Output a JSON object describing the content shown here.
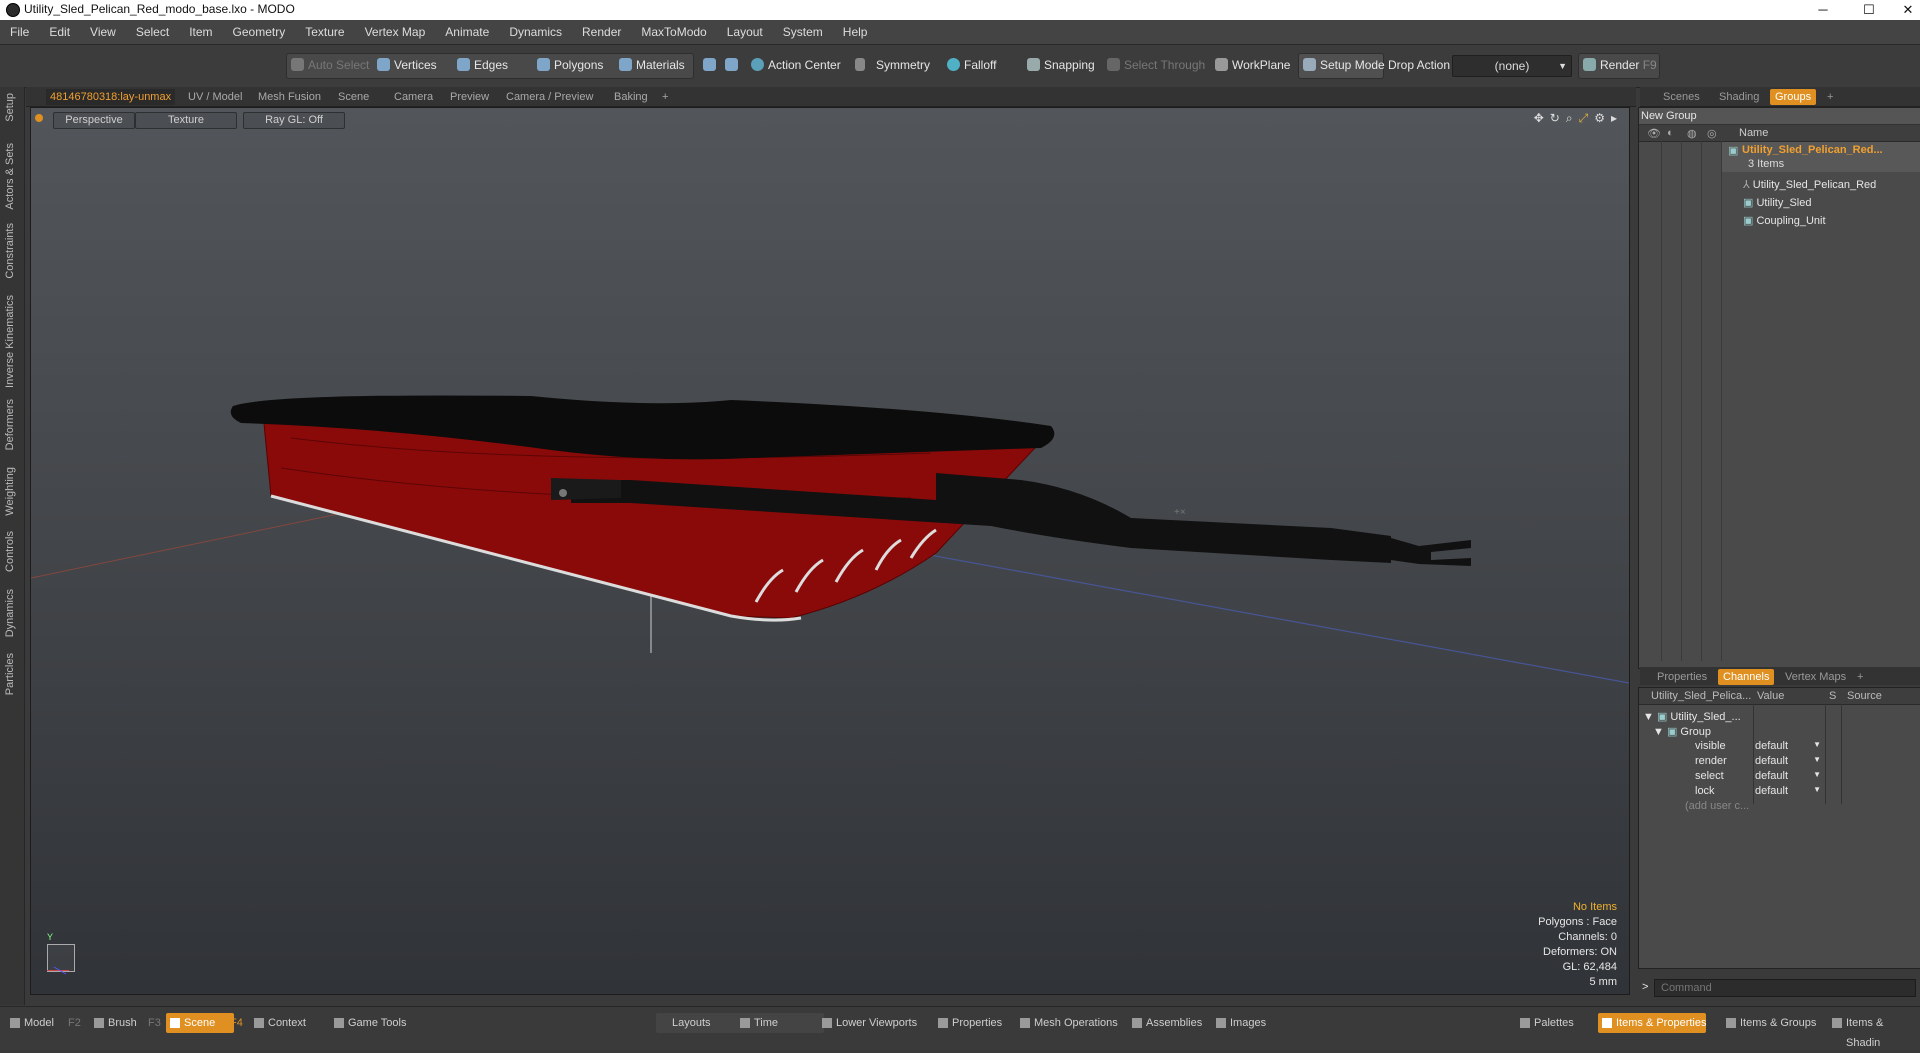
{
  "window": {
    "title": "Utility_Sled_Pelican_Red_modo_base.lxo - MODO",
    "min": "─",
    "max": "☐",
    "close": "✕"
  },
  "menu": [
    "File",
    "Edit",
    "View",
    "Select",
    "Item",
    "Geometry",
    "Texture",
    "Vertex Map",
    "Animate",
    "Dynamics",
    "Render",
    "MaxToModo",
    "Layout",
    "System",
    "Help"
  ],
  "toolbar": {
    "auto_select": "Auto Select",
    "vertices": "Vertices",
    "edges": "Edges",
    "polygons": "Polygons",
    "materials": "Materials",
    "action_center": "Action Center",
    "symmetry": "Symmetry",
    "falloff": "Falloff",
    "snapping": "Snapping",
    "select_through": "Select Through",
    "workplane": "WorkPlane",
    "setup_mode": "Setup Mode",
    "drop_action": "Drop Action",
    "drop_value": "(none)",
    "render": "Render",
    "render_key": "F9"
  },
  "left_tabs": [
    "Setup",
    "Actors & Sets",
    "Constraints",
    "Inverse Kinematics",
    "Deformers",
    "Weighting",
    "Controls",
    "Dynamics",
    "Particles"
  ],
  "viewport_tabs": [
    "48146780318:lay-unmax",
    "UV / Model",
    "Mesh Fusion",
    "Scene",
    "Camera",
    "Preview",
    "Camera / Preview",
    "Baking",
    "+"
  ],
  "viewport": {
    "perspective": "Perspective",
    "texture": "Texture",
    "raygl": "Ray GL: Off",
    "info": {
      "items": "No Items",
      "polygons": "Polygons : Face",
      "channels": "Channels: 0",
      "deformers": "Deformers: ON",
      "gl": "GL: 62,484",
      "size": "5 mm"
    },
    "axis_y": "Y"
  },
  "right_tabs": [
    "Scenes",
    "Shading",
    "Groups",
    "+"
  ],
  "groups": {
    "new_group": "New Group",
    "name_header": "Name",
    "root": "Utility_Sled_Pelican_Red...",
    "count": "3 Items",
    "children": [
      "Utility_Sled_Pelican_Red",
      "Utility_Sled",
      "Coupling_Unit"
    ]
  },
  "channel_tabs": [
    "Properties",
    "Channels",
    "Vertex Maps",
    "+"
  ],
  "channels": {
    "headers": [
      "Utility_Sled_Pelica...",
      "Value",
      "S",
      "Source"
    ],
    "item": "Utility_Sled_...",
    "group": "Group",
    "rows": [
      {
        "name": "visible",
        "value": "default"
      },
      {
        "name": "render",
        "value": "default"
      },
      {
        "name": "select",
        "value": "default"
      },
      {
        "name": "lock",
        "value": "default"
      }
    ],
    "add": "(add user c..."
  },
  "command": {
    "prompt": ">",
    "placeholder": "Command"
  },
  "bottom": {
    "model": "Model",
    "f2": "F2",
    "brush": "Brush",
    "f3": "F3",
    "scene": "Scene",
    "f4": "F4",
    "context": "Context",
    "game_tools": "Game Tools",
    "layouts": "Layouts",
    "time": "Time",
    "lower_viewports": "Lower Viewports",
    "properties": "Properties",
    "mesh_operations": "Mesh Operations",
    "assemblies": "Assemblies",
    "images": "Images",
    "palettes": "Palettes",
    "items_properties": "Items & Properties",
    "items_groups": "Items & Groups",
    "items_shading": "Items & Shadin"
  },
  "colors": {
    "accent": "#e09020",
    "sled": "#8b0000"
  }
}
